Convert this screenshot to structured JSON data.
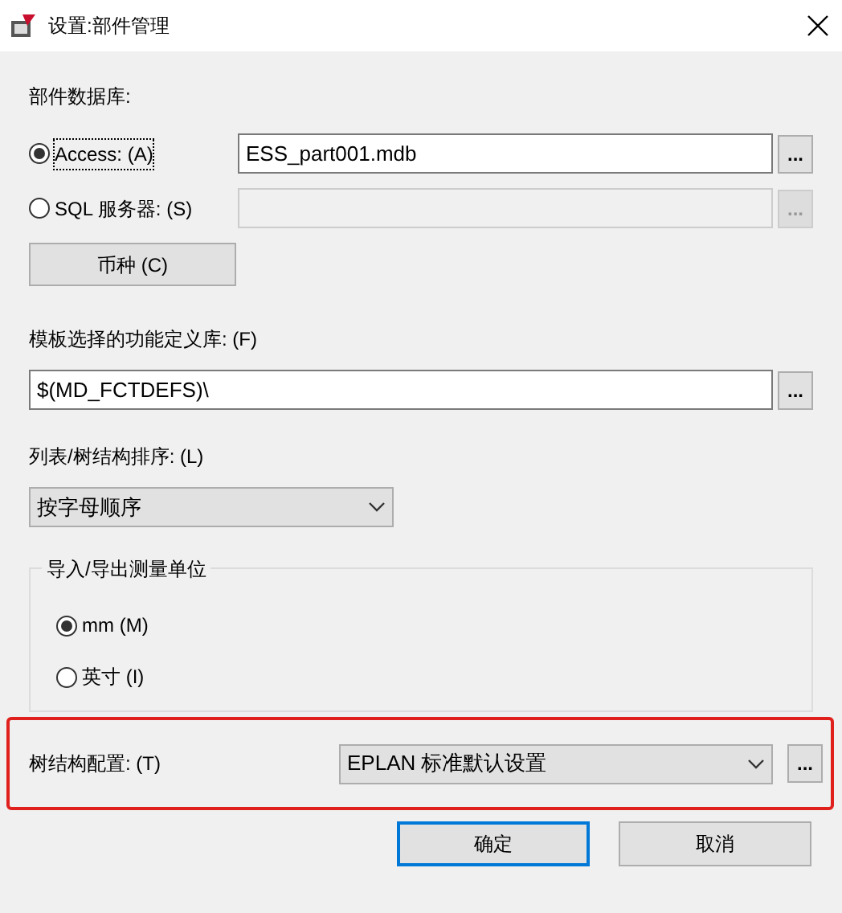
{
  "window": {
    "title": "设置:部件管理"
  },
  "database": {
    "label": "部件数据库:",
    "options": [
      {
        "label": "Access: (A)",
        "selected": true,
        "focused": true,
        "disabled": false,
        "value": "ESS_part001.mdb",
        "browse": "..."
      },
      {
        "label": "SQL 服务器: (S)",
        "selected": false,
        "focused": false,
        "disabled": true,
        "browse": "..."
      }
    ],
    "currency_button": "币种 (C)"
  },
  "function_library": {
    "label": "模板选择的功能定义库: (F)",
    "value": "$(MD_FCTDEFS)\\",
    "browse": "..."
  },
  "sorting": {
    "label": "列表/树结构排序: (L)",
    "value": "按字母顺序"
  },
  "units": {
    "title": "导入/导出测量单位",
    "options": [
      {
        "label": "mm (M)",
        "selected": true
      },
      {
        "label": "英寸 (I)",
        "selected": false
      }
    ]
  },
  "tree_config": {
    "label": "树结构配置: (T)",
    "value": "EPLAN 标准默认设置",
    "browse": "...",
    "highlighted": true
  },
  "buttons": [
    {
      "label": "确定",
      "default": true
    },
    {
      "label": "取消",
      "default": false
    }
  ]
}
